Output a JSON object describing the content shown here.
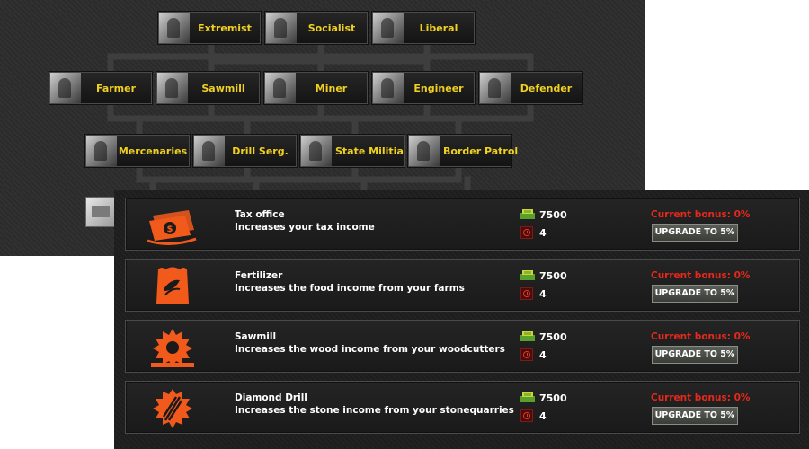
{
  "colors": {
    "node_label": "#f0d020",
    "bonus_red": "#e8281b",
    "accent_orange": "#f25a1c",
    "panel_bg": "#2c2c2c"
  },
  "tech_tree": {
    "tier1": [
      {
        "label": "Extremist",
        "icon": "militant-photo-icon"
      },
      {
        "label": "Socialist",
        "icon": "raised-fist-icon"
      },
      {
        "label": "Liberal",
        "icon": "eagle-emblem-icon"
      }
    ],
    "tier2": [
      {
        "label": "Farmer",
        "icon": "tractor-photo-icon"
      },
      {
        "label": "Sawmill",
        "icon": "sawmill-photo-icon"
      },
      {
        "label": "Miner",
        "icon": "miner-photo-icon"
      },
      {
        "label": "Engineer",
        "icon": "engineer-photo-icon"
      },
      {
        "label": "Defender",
        "icon": "tower-photo-icon"
      }
    ],
    "tier3": [
      {
        "label": "Mercenaries",
        "icon": "mercenary-photo-icon"
      },
      {
        "label": "Drill Serg.",
        "icon": "soldiers-photo-icon"
      },
      {
        "label": "State Militia",
        "icon": "militia-photo-icon"
      },
      {
        "label": "Border Patrol",
        "icon": "patrol-vehicle-photo-icon"
      }
    ],
    "locked_icon": "locked-building-icon"
  },
  "upgrades": [
    {
      "title": "Tax office",
      "description": "Increases your tax income",
      "cost": "7500",
      "time": "4",
      "bonus": "Current bonus: 0%",
      "button": "UPGRADE TO 5%",
      "icon": "money-bill-icon"
    },
    {
      "title": "Fertilizer",
      "description": "Increases the food income from your farms",
      "cost": "7500",
      "time": "4",
      "bonus": "Current bonus: 0%",
      "button": "UPGRADE TO 5%",
      "icon": "fertilizer-sack-icon"
    },
    {
      "title": "Sawmill",
      "description": "Increases the wood income from your woodcutters",
      "cost": "7500",
      "time": "4",
      "bonus": "Current bonus: 0%",
      "button": "UPGRADE TO 5%",
      "icon": "saw-blade-icon"
    },
    {
      "title": "Diamond Drill",
      "description": "Increases the stone income from your stonequarries",
      "cost": "7500",
      "time": "4",
      "bonus": "Current bonus: 0%",
      "button": "UPGRADE TO 5%",
      "icon": "diamond-drill-icon"
    }
  ]
}
